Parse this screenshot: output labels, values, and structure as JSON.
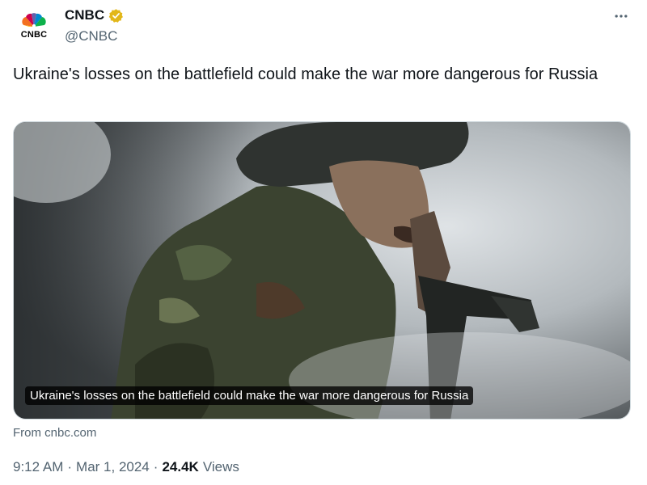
{
  "author": {
    "display_name": "CNBC",
    "handle": "@CNBC",
    "avatar_text": "CNBC",
    "verified_color": "#e2b719"
  },
  "tweet": {
    "text": "Ukraine's losses on the battlefield could make the war more dangerous for Russia"
  },
  "media": {
    "caption": "Ukraine's losses on the battlefield could make the war more dangerous for Russia",
    "source": "From cnbc.com"
  },
  "meta": {
    "time": "9:12 AM",
    "separator1": "·",
    "date": "Mar 1, 2024",
    "separator2": "·",
    "views_count": "24.4K",
    "views_label": "Views"
  },
  "icons": {
    "more": "more-horizontal-icon",
    "verified": "verified-badge-icon"
  }
}
